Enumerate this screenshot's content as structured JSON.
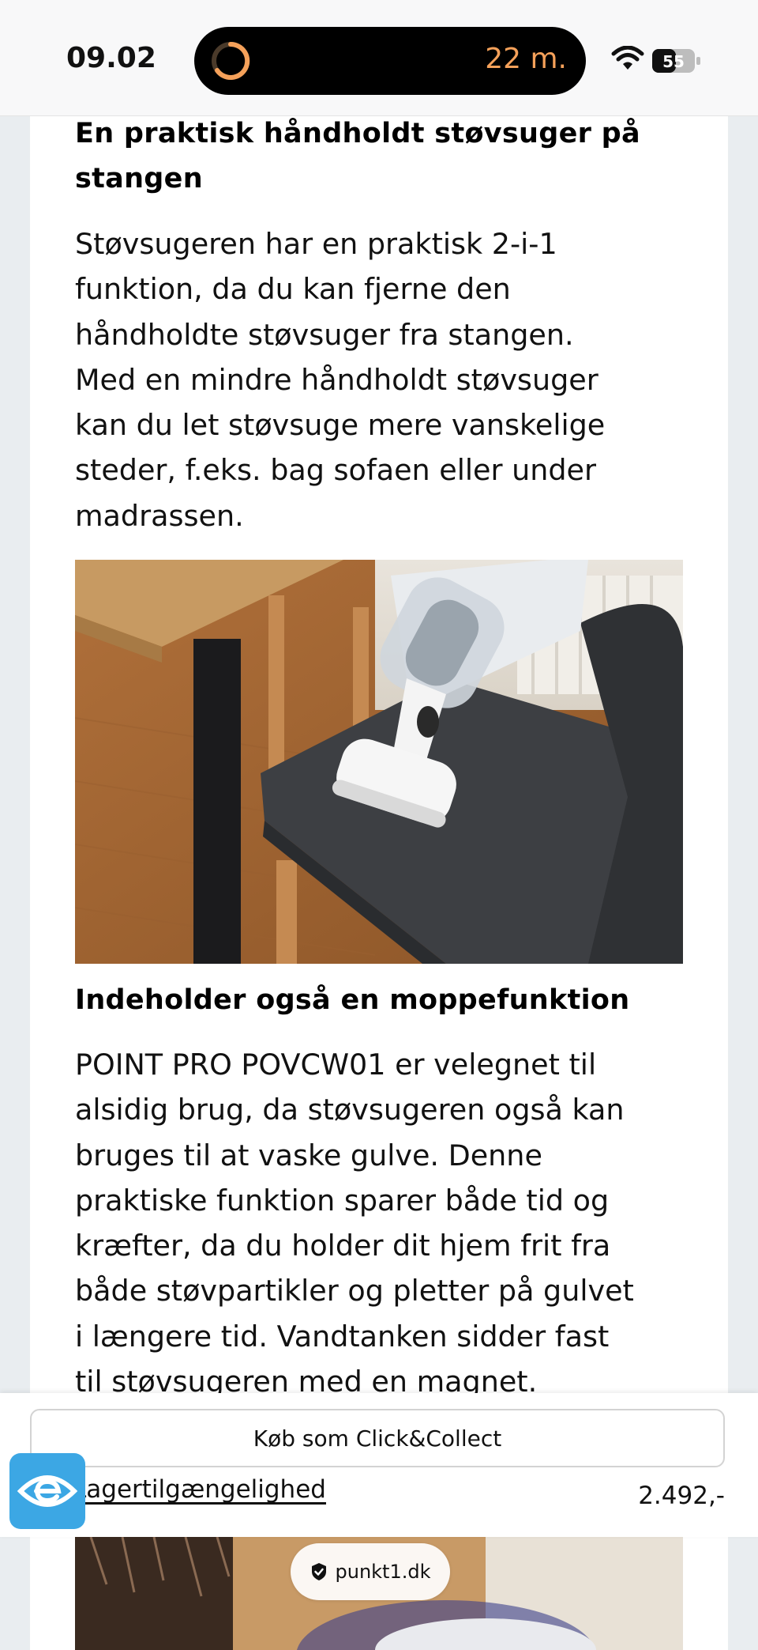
{
  "status_bar": {
    "time": "09.02",
    "activity_timer": "22 m.",
    "battery_level": "55",
    "icons": [
      "timer-ring-icon",
      "wifi-icon",
      "battery-icon"
    ]
  },
  "article": {
    "section1": {
      "heading_line1": "En praktisk håndholdt støvsuger på",
      "heading_line2": "stangen",
      "paragraph": "Støvsugeren har en praktisk 2-i-1\nfunktion, da du kan fjerne den\nhåndholdte støvsuger fra stangen.\nMed en mindre håndholdt støvsuger\nkan du let støvsuge mere vanskelige\nsteder, f.eks. bag sofaen eller under\nmadrassen."
    },
    "section2": {
      "heading": "Indeholder også en moppefunktion",
      "paragraph": "POINT PRO POVCW01 er velegnet til\nalsidig brug, da støvsugeren også kan\nbruges til at vaske gulve. Denne\npraktiske funktion sparer både tid og\nkræfter, da du holder dit hjem frit fra\nbåde støvpartikler og pletter på gulvet\ni længere tid. Vandtanken sidder fast\ntil støvsugeren med en magnet."
    }
  },
  "purchase_bar": {
    "click_collect_label": "Køb som Click&Collect",
    "stock_link": "Lagertilgængelighed",
    "price": "2.492,-"
  },
  "browser": {
    "domain": "punkt1.dk"
  },
  "colors": {
    "accessibility_button": "#3ca7e4",
    "timer_accent": "#f5a15a"
  }
}
